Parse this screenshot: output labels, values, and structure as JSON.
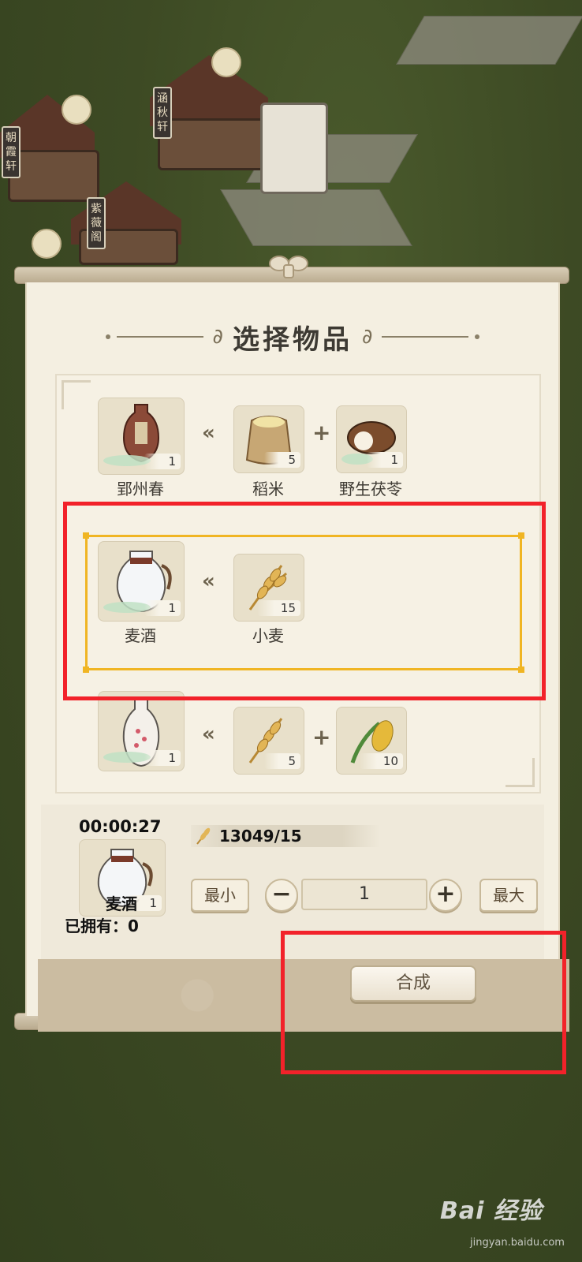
{
  "background": {
    "signs": [
      "涵秋轩",
      "朝霞轩",
      "紫薇阁"
    ]
  },
  "dialog": {
    "title": "选择物品",
    "recipes": [
      {
        "product": {
          "name": "郢州春",
          "count": "1",
          "icon": "wine-jar-icon"
        },
        "ingredients": [
          {
            "name": "稻米",
            "count": "5",
            "icon": "rice-sack-icon"
          },
          {
            "name": "野生茯苓",
            "count": "1",
            "icon": "poria-mushroom-icon"
          }
        ]
      },
      {
        "product": {
          "name": "麦酒",
          "count": "1",
          "icon": "wheat-wine-jug-icon"
        },
        "ingredients": [
          {
            "name": "小麦",
            "count": "15",
            "icon": "wheat-icon"
          }
        ],
        "selected": true
      },
      {
        "product": {
          "name": "",
          "count": "1",
          "icon": "flower-vase-bottle-icon"
        },
        "ingredients": [
          {
            "name": "",
            "count": "5",
            "icon": "wheat-icon"
          },
          {
            "name": "",
            "count": "10",
            "icon": "corn-icon"
          }
        ]
      }
    ],
    "craft": {
      "timer": "00:00:27",
      "item_name": "麦酒",
      "item_count": "1",
      "owned_label": "已拥有：0",
      "resource_text": "13049/15",
      "min_label": "最小",
      "max_label": "最大",
      "minus_label": "−",
      "plus_label": "+",
      "quantity": "1",
      "synthesize_label": "合成"
    }
  },
  "watermark": {
    "brand": "Bai 经验",
    "url": "jingyan.baidu.com"
  },
  "colors": {
    "highlight_frame": "#f0b523",
    "annotation_red": "#f2222a",
    "panel_bg": "#f4efe1"
  }
}
